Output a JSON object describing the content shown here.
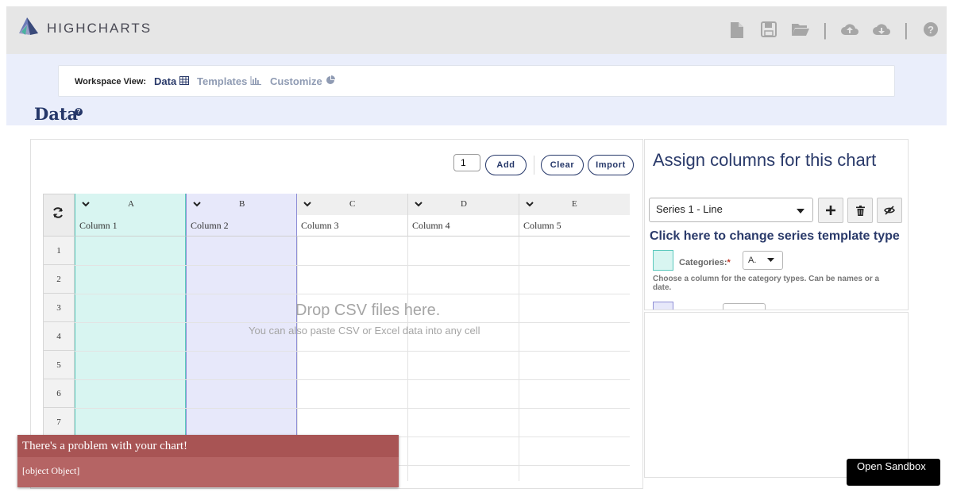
{
  "app": {
    "logo_text": "HIGHCHARTS",
    "toolbar_icons": [
      "new-file-icon",
      "save-icon",
      "open-folder-icon",
      "cloud-upload-icon",
      "cloud-download-icon",
      "help-icon"
    ]
  },
  "workspace": {
    "label": "Workspace View:",
    "views": [
      {
        "label": "Data",
        "icon": "table-icon",
        "active": true
      },
      {
        "label": "Templates",
        "icon": "bar-chart-icon",
        "active": false
      },
      {
        "label": "Customize",
        "icon": "pie-chart-icon",
        "active": false
      }
    ]
  },
  "page": {
    "title": "Data",
    "help_glyph": "?"
  },
  "data_panel": {
    "row_count": "1",
    "add_label": "Add",
    "clear_label": "Clear",
    "import_label": "Import",
    "columns": [
      {
        "letter": "A",
        "name": "Column 1"
      },
      {
        "letter": "B",
        "name": "Column 2"
      },
      {
        "letter": "C",
        "name": "Column 3"
      },
      {
        "letter": "D",
        "name": "Column 4"
      },
      {
        "letter": "E",
        "name": "Column 5"
      }
    ],
    "rows": [
      "1",
      "2",
      "3",
      "4",
      "5",
      "6",
      "7"
    ],
    "drop_title": "Drop CSV files here.",
    "drop_subtitle": "You can also paste CSV or Excel data into any cell"
  },
  "assign_panel": {
    "title": "Assign columns for this chart",
    "series_value": "Series 1 - Line",
    "change_link": "Click here to change series template type",
    "categories_label": "Categories:",
    "required_mark": "*",
    "categories_value": "A.",
    "categories_help": "Choose a column for the category types. Can be names or a date."
  },
  "toast": {
    "title": "There's a problem with your chart!",
    "body": "[object Object]"
  },
  "sandbox_button": "Open Sandbox",
  "colors": {
    "column_a": "#d8f5f1",
    "column_a_border": "#5bc8bd",
    "column_b": "#e7e8fa",
    "column_b_border": "#8f8fd6",
    "brand_navy": "#253769",
    "toast_head": "#a85454",
    "toast_body": "#b56464"
  }
}
